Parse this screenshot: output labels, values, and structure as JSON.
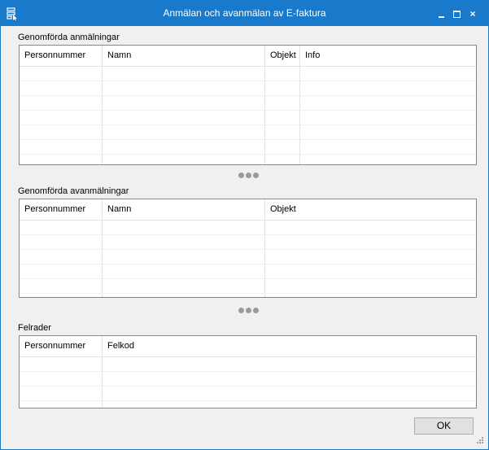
{
  "window": {
    "title": "Anmälan och avanmälan av E-faktura",
    "icon": "app-icon",
    "controls": {
      "minimize": "minimize-icon",
      "maximize": "maximize-icon",
      "close": "×"
    }
  },
  "registrations": {
    "label": "Genomförda anmälningar",
    "columns": [
      "Personnummer",
      "Namn",
      "Objekt",
      "Info"
    ],
    "row_count": 7
  },
  "deregistrations": {
    "label": "Genomförda avanmälningar",
    "columns": [
      "Personnummer",
      "Namn",
      "Objekt"
    ],
    "row_count": 5
  },
  "errors": {
    "label": "Felrader",
    "columns": [
      "Personnummer",
      "Felkod"
    ],
    "row_count": 4
  },
  "footer": {
    "ok_label": "OK"
  },
  "colors": {
    "titlebar": "#1979ca",
    "accent": "#1979ca"
  }
}
